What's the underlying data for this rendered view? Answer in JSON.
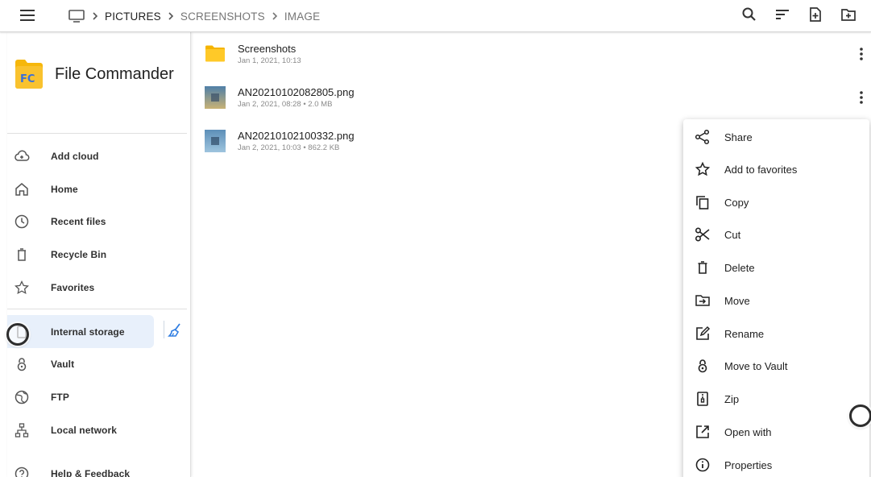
{
  "topbar": {
    "breadcrumb": [
      {
        "label": "PICTURES",
        "dim": false
      },
      {
        "label": "SCREENSHOTS",
        "dim": true
      },
      {
        "label": "IMAGE",
        "dim": true
      }
    ],
    "actions": [
      "search-icon",
      "sort-icon",
      "new-file-icon",
      "new-folder-icon"
    ]
  },
  "app": {
    "name": "File Commander",
    "logo_text": "FC",
    "accent": "#f5b400",
    "logo_letters": "#3b6fd8"
  },
  "sidebar": {
    "items": [
      {
        "label": "Add cloud",
        "icon": "cloud-add-icon"
      },
      {
        "label": "Home",
        "icon": "home-icon"
      },
      {
        "label": "Recent files",
        "icon": "clock-icon"
      },
      {
        "label": "Recycle Bin",
        "icon": "trash-icon"
      },
      {
        "label": "Favorites",
        "icon": "star-icon"
      },
      {
        "label": "Internal storage",
        "icon": "storage-icon",
        "active": true
      },
      {
        "label": "Vault",
        "icon": "lock-icon"
      },
      {
        "label": "FTP",
        "icon": "globe-icon"
      },
      {
        "label": "Local network",
        "icon": "network-icon"
      },
      {
        "label": "Help & Feedback",
        "icon": "help-icon"
      }
    ]
  },
  "files": [
    {
      "name": "Screenshots",
      "meta": "Jan 1, 2021, 10:13",
      "type": "folder"
    },
    {
      "name": "AN20210102082805.png",
      "meta": "Jan 2, 2021, 08:28 • 2.0 MB",
      "type": "image"
    },
    {
      "name": "AN20210102100332.png",
      "meta": "Jan 2, 2021, 10:03 • 862.2 KB",
      "type": "image"
    }
  ],
  "context_menu": {
    "items": [
      {
        "label": "Share",
        "icon": "share-icon"
      },
      {
        "label": "Add to favorites",
        "icon": "star-icon"
      },
      {
        "label": "Copy",
        "icon": "copy-icon"
      },
      {
        "label": "Cut",
        "icon": "scissors-icon"
      },
      {
        "label": "Delete",
        "icon": "trash-icon"
      },
      {
        "label": "Move",
        "icon": "move-icon"
      },
      {
        "label": "Rename",
        "icon": "edit-icon"
      },
      {
        "label": "Move to Vault",
        "icon": "lock-icon"
      },
      {
        "label": "Zip",
        "icon": "zip-icon"
      },
      {
        "label": "Open with",
        "icon": "open-external-icon"
      },
      {
        "label": "Properties",
        "icon": "info-icon"
      }
    ]
  }
}
